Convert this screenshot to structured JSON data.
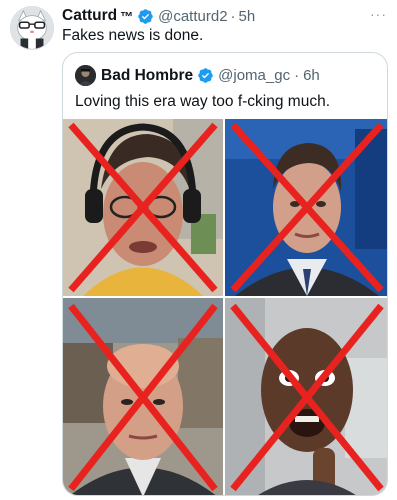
{
  "tweet": {
    "author_name": "Catturd",
    "author_tm": "™",
    "handle": "@catturd2",
    "separator": "·",
    "time": "5h",
    "text": "Fakes news is done.",
    "more_icon": "more-icon",
    "more_label": "···"
  },
  "quote": {
    "author_name": "Bad Hombre",
    "handle": "@joma_gc",
    "separator": "·",
    "time": "6h",
    "text": "Loving this era way too f-cking much."
  },
  "colors": {
    "verified": "#1d9bf0",
    "x_mark": "#e8231f",
    "muted_text": "#536471",
    "border": "#cfd9de"
  },
  "media": {
    "images": [
      {
        "name": "person-headphones-crossed",
        "icon": "crossed-out-photo"
      },
      {
        "name": "person-suit-blue-crossed",
        "icon": "crossed-out-photo"
      },
      {
        "name": "person-bald-crossed",
        "icon": "crossed-out-photo"
      },
      {
        "name": "person-surprised-crossed",
        "icon": "crossed-out-photo"
      }
    ]
  }
}
